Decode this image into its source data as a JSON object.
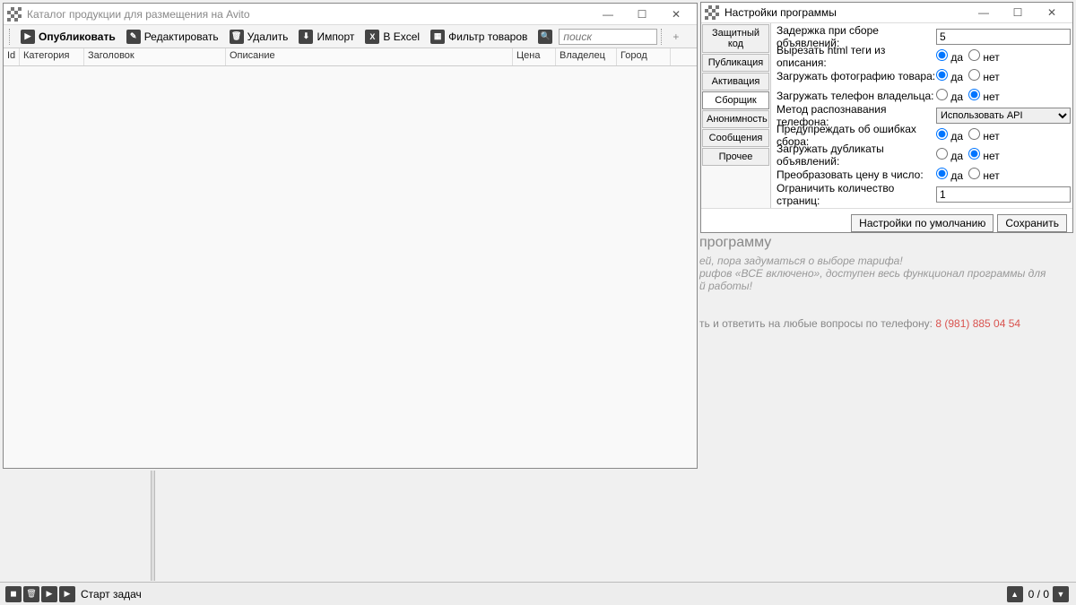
{
  "main": {
    "title": "Каталог продукции для размещения на Avito",
    "toolbar": {
      "publish": "Опубликовать",
      "edit": "Редактировать",
      "delete": "Удалить",
      "import": "Импорт",
      "excel": "В Excel",
      "filter": "Фильтр товаров",
      "search_ph": "поиск"
    },
    "cols": {
      "id": "Id",
      "cat": "Категория",
      "title": "Заголовок",
      "desc": "Описание",
      "price": "Цена",
      "owner": "Владелец",
      "city": "Город"
    }
  },
  "settings": {
    "title": "Настройки программы",
    "tabs": {
      "t1": "Защитный код",
      "t2": "Публикация",
      "t3": "Активация",
      "t4": "Сборщик",
      "t5": "Анонимность",
      "t6": "Сообщения",
      "t7": "Прочее"
    },
    "form": {
      "delay_lbl": "Задержка при сборе объявлений:",
      "delay_val": "5",
      "strip_lbl": "Вырезать html теги из описания:",
      "photo_lbl": "Загружать фотографию товара:",
      "phone_lbl": "Загружать телефон владельца:",
      "method_lbl": "Метод распознавания телефона:",
      "method_val": "Использовать API",
      "warn_lbl": "Предупреждать об ошибках сбора:",
      "dup_lbl": "Загружать дубликаты объявлений:",
      "pricenum_lbl": "Преобразовать цену в число:",
      "pages_lbl": "Ограничить количество страниц:",
      "pages_val": "1",
      "yes": "да",
      "no": "нет"
    },
    "btn_default": "Настройки по умолчанию",
    "btn_save": "Сохранить"
  },
  "bg": {
    "h": "программу",
    "l1": "ей, пора задуматься о выборе тарифа!",
    "l2": "рифов «ВСЕ включено», доступен весь функционал программы для",
    "l3": "й работы!",
    "ph_pre": "ть и ответить на любые вопросы по телефону: ",
    "phone": "8 (981) 885 04 54"
  },
  "bottom": {
    "start": "Старт задач",
    "count": "0  /  0"
  }
}
